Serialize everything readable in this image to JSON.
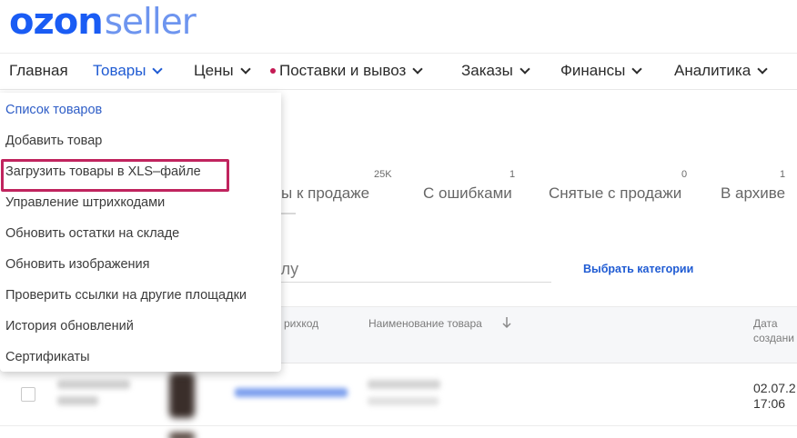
{
  "logo": {
    "brand": "ozon",
    "suffix": "seller"
  },
  "nav": [
    {
      "label": "Главная",
      "active": false,
      "dropdown": false,
      "dot": false
    },
    {
      "label": "Товары",
      "active": true,
      "dropdown": true,
      "dot": false
    },
    {
      "label": "Цены",
      "active": false,
      "dropdown": true,
      "dot": false
    },
    {
      "label": "Поставки и вывоз",
      "active": false,
      "dropdown": true,
      "dot": true
    },
    {
      "label": "Заказы",
      "active": false,
      "dropdown": true,
      "dot": false
    },
    {
      "label": "Финансы",
      "active": false,
      "dropdown": true,
      "dot": false
    },
    {
      "label": "Аналитика",
      "active": false,
      "dropdown": true,
      "dot": false
    }
  ],
  "dropdown": {
    "items": [
      "Список товаров",
      "Добавить товар",
      "Загрузить товары в XLS–файле",
      "Управление штрихкодами",
      "Обновить остатки на складе",
      "Обновить изображения",
      "Проверить ссылки на другие площадки",
      "История обновлений",
      "Сертификаты"
    ],
    "highlighted_index": 2
  },
  "tabs": [
    {
      "label": "вы к продаже",
      "count": "25K"
    },
    {
      "label": "С ошибками",
      "count": "1"
    },
    {
      "label": "Снятые с продажи",
      "count": "0"
    },
    {
      "label": "В архиве",
      "count": "1"
    }
  ],
  "search": {
    "visible_fragment": "улу"
  },
  "choose_categories": "Выбрать категории",
  "table": {
    "headers": {
      "col_partial": "рихкод",
      "name": "Наименование товара",
      "date_line1": "Дата",
      "date_line2": "создани"
    }
  },
  "row": {
    "date_line1": "02.07.2",
    "date_line2": "17:06"
  },
  "colors": {
    "brand_blue": "#1a5cf4",
    "active_blue": "#1f5bd3",
    "highlight": "#c0245e",
    "dot": "#c41a54"
  }
}
